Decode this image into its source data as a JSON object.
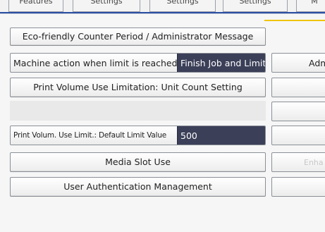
{
  "tabs": [
    "Features",
    "Settings",
    "Settings",
    "Settings",
    "M"
  ],
  "buttons": {
    "eco_message": "Eco-friendly Counter Period / Administrator Message",
    "machine_action_label": "Machine action when limit is reached",
    "machine_action_value": "Finish Job and Limit",
    "unit_count": "Print Volume Use Limitation: Unit Count Setting",
    "default_limit_label": "Print Volum. Use Limit.: Default Limit Value",
    "default_limit_value": "500",
    "media_slot": "Media Slot Use",
    "user_auth": "User Authentication Management"
  },
  "right_column": {
    "item1": "Adm",
    "item2": "",
    "item3": "",
    "item4": "",
    "item5": "Enha",
    "item6": ""
  }
}
